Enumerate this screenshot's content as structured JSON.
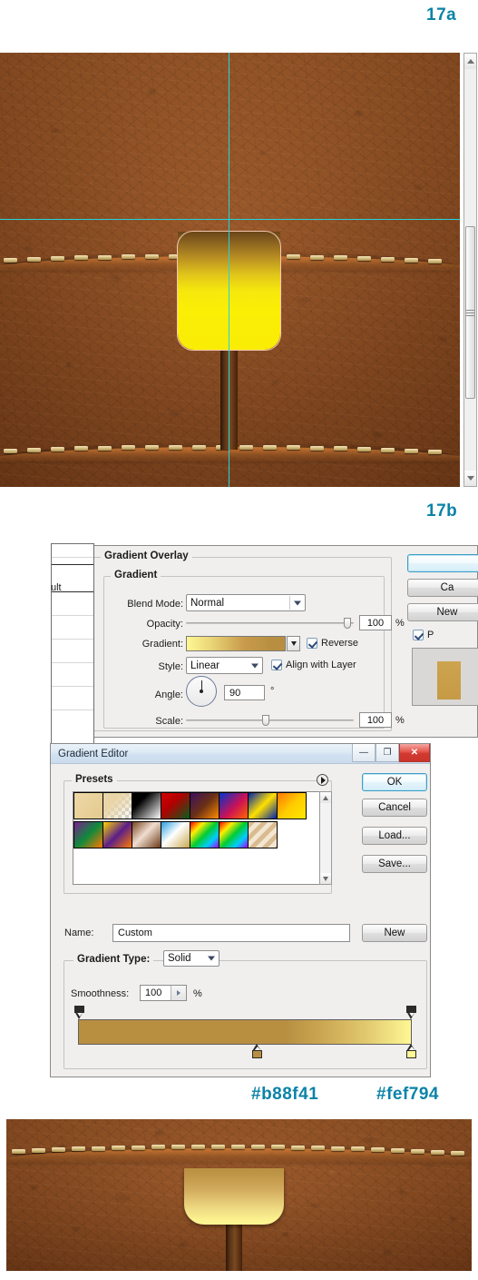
{
  "figures": {
    "label_a": "17a",
    "label_b": "17b"
  },
  "swatch_labels": {
    "dark": "#b88f41",
    "light": "#fef794"
  },
  "colors": {
    "accent_label": "#0c83a8",
    "gradient_dark": "#b88f41",
    "gradient_light": "#fef794",
    "leather_base": "#8a4a1e",
    "guide": "#22d3e0",
    "marquee": "#f2c8b0",
    "strap_yellow_top": "#6b4518",
    "strap_yellow_bottom": "#fbef06"
  },
  "layer_style": {
    "section_title": "Gradient Overlay",
    "group_title": "Gradient",
    "fields": {
      "blend_mode_label": "Blend Mode:",
      "blend_mode_value": "Normal",
      "opacity_label": "Opacity:",
      "opacity_value": "100",
      "opacity_unit": "%",
      "gradient_label": "Gradient:",
      "reverse_label": "Reverse",
      "style_label": "Style:",
      "style_value": "Linear",
      "align_label": "Align with Layer",
      "angle_label": "Angle:",
      "angle_value": "90",
      "angle_unit": "°",
      "scale_label": "Scale:",
      "scale_value": "100",
      "scale_unit": "%"
    },
    "side_buttons": {
      "ok": "",
      "cancel": "Ca",
      "new_style": "New",
      "preview": "P"
    },
    "layers_stub_text": "ult"
  },
  "gradient_editor": {
    "window_title": "Gradient Editor",
    "window_buttons": {
      "minimize": "—",
      "maximize": "❐",
      "close": "✕"
    },
    "presets_label": "Presets",
    "buttons": {
      "ok": "OK",
      "cancel": "Cancel",
      "load": "Load...",
      "save": "Save...",
      "new": "New"
    },
    "name_label": "Name:",
    "name_value": "Custom",
    "gradient_type_label": "Gradient Type:",
    "gradient_type_value": "Solid",
    "smoothness_label": "Smoothness:",
    "smoothness_value": "100",
    "smoothness_unit": "%",
    "preset_swatches": [
      "linear-gradient(135deg,#f0d9a8,#e2c98f)",
      "linear-gradient(135deg,#e9d5a8,rgba(233,213,168,0))",
      "linear-gradient(135deg,#000000,#ffffff)",
      "linear-gradient(135deg,#d40000,#0a5c1e)",
      "linear-gradient(135deg,#3b1060,#ff8c00)",
      "linear-gradient(135deg,#0033cc,#ff2200)",
      "linear-gradient(135deg,#0022aa,#ffe000)",
      "linear-gradient(135deg,#ff7700,#ffe000)",
      "linear-gradient(135deg,#7a1f8f,#0f8a3c)",
      "linear-gradient(135deg,#ffd400,#5a1f8a)",
      "linear-gradient(135deg,#7a4520,#f0ddd0)",
      "linear-gradient(135deg,#2a9fe0,#d8c070)",
      "linear-gradient(135deg,#ff0000,#00ccff)",
      "linear-gradient(135deg,#ffffff,#ff00aa)",
      "linear-gradient(135deg,#d9bb90,#f3e6d2)"
    ],
    "ramp": {
      "stop_left_color": "#b88f41",
      "stop_right_color": "#fef794",
      "mid_stop_color": "#b88f41",
      "end_stop_color": "#fef794",
      "css": "linear-gradient(90deg,#b88f41 0%,#b88f41 62%,#d9bd62 80%,#fef794 100%)"
    }
  }
}
